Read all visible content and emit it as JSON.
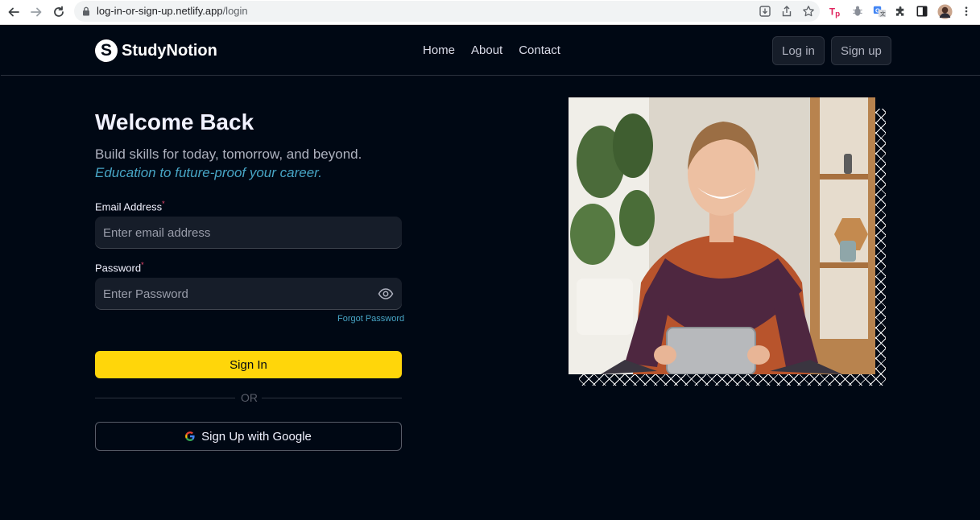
{
  "browser": {
    "url_host": "log-in-or-sign-up.netlify.app",
    "url_path": "/login"
  },
  "navbar": {
    "logo_letter": "S",
    "brand": "StudyNotion",
    "links": [
      "Home",
      "About",
      "Contact"
    ],
    "login_label": "Log in",
    "signup_label": "Sign up"
  },
  "form": {
    "heading": "Welcome Back",
    "subtitle": "Build skills for today, tomorrow, and beyond.",
    "tagline": "Education to future-proof your career.",
    "email_label": "Email Address",
    "email_placeholder": "Enter email address",
    "password_label": "Password",
    "password_placeholder": "Enter Password",
    "required_mark": "*",
    "forgot_label": "Forgot Password",
    "signin_label": "Sign In",
    "divider_label": "OR",
    "google_label": "Sign Up with Google"
  },
  "colors": {
    "background": "#000814",
    "accent": "#ffd60a",
    "tagline": "#47a5c5",
    "required": "#ef476f"
  }
}
